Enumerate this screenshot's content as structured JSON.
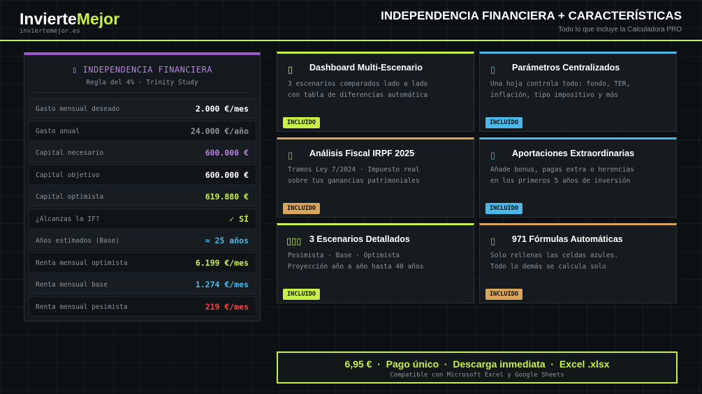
{
  "header": {
    "logo_part1": "Invierte",
    "logo_part2": "Mejor",
    "logo_sub": "inviertemejor.es",
    "title": "INDEPENDENCIA FINANCIERA + CARACTERÍSTICAS",
    "subtitle": "Todo lo que incluye la Calculadora PRO"
  },
  "panel": {
    "icon": "target-icon",
    "title": "INDEPENDENCIA FINANCIERA",
    "subtitle": "Regla del 4% · Trinity Study",
    "rows": [
      {
        "label": "Gasto mensual deseado",
        "value": "2.000 €/mes",
        "color": "#ffffff"
      },
      {
        "label": "Gasto anual",
        "value": "24.000 €/año",
        "color": "#8a949b"
      },
      {
        "label": "Capital necesario",
        "value": "600.000 €",
        "color": "#b77fe0"
      },
      {
        "label": "Capital objetivo",
        "value": "600.000 €",
        "color": "#ffffff"
      },
      {
        "label": "Capital optimista",
        "value": "619.880 €",
        "color": "#c8f04a"
      },
      {
        "label": "¿Alcanzas la IF?",
        "value": "✓ SÍ",
        "color": "#c8f04a"
      },
      {
        "label": "Años estimados (Base)",
        "value": "≈ 25 años",
        "color": "#4cb8e8"
      },
      {
        "label": "Renta mensual optimista",
        "value": "6.199 €/mes",
        "color": "#c8f04a"
      },
      {
        "label": "Renta mensual base",
        "value": "1.274 €/mes",
        "color": "#4cb8e8"
      },
      {
        "label": "Renta mensual pesimista",
        "value": "219 €/mes",
        "color": "#e84a4a"
      }
    ]
  },
  "cards": [
    {
      "icon": "dashboard-icon",
      "title": "Dashboard Multi-Escenario",
      "line1": "3 escenarios comparados lado a lado",
      "line2": "con tabla de diferencias automática",
      "badge": "INCLUIDO",
      "accent": "#c8f04a"
    },
    {
      "icon": "sliders-icon",
      "title": "Parámetros Centralizados",
      "line1": "Una hoja controla todo: fondo, TER,",
      "line2": "inflación, tipo impositivo y más",
      "badge": "INCLUIDO",
      "accent": "#4cb8e8"
    },
    {
      "icon": "tax-icon",
      "title": "Análisis Fiscal IRPF 2025",
      "line1": "Tramos Ley 7/2024 · Impuesto real",
      "line2": "sobre tus ganancias patrimoniales",
      "badge": "INCLUIDO",
      "accent": "#d9a55a"
    },
    {
      "icon": "coins-icon",
      "title": "Aportaciones Extraordinarias",
      "line1": "Añade bonus, pagas extra o herencias",
      "line2": "en los primeros 5 años de inversión",
      "badge": "INCLUIDO",
      "accent": "#4cb8e8"
    },
    {
      "icon": "scenarios-icon",
      "title": "3 Escenarios Detallados",
      "line1": "Pesimista · Base · Optimista",
      "line2": "Proyección año a año hasta 40 años",
      "badge": "INCLUIDO",
      "accent": "#c8f04a"
    },
    {
      "icon": "formula-icon",
      "title": "971 Fórmulas Automáticas",
      "line1": "Solo rellenas las celdas azules.",
      "line2": "Todo lo demás se calcula solo",
      "badge": "INCLUIDO",
      "accent": "#d9a55a"
    }
  ],
  "footer": {
    "main": "6,95 €  ·  Pago único  ·  Descarga inmediata  ·  Excel .xlsx",
    "sub": "Compatible con Microsoft Excel y Google Sheets"
  }
}
